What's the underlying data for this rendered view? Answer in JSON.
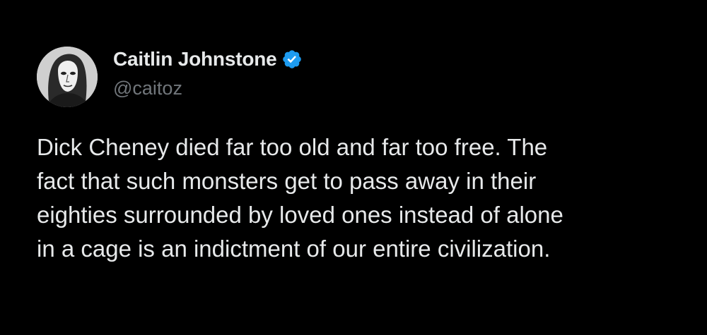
{
  "tweet": {
    "author": {
      "display_name": "Caitlin Johnstone",
      "handle": "@caitoz",
      "verified": true,
      "verified_icon": "verified-badge-icon",
      "verified_color": "#1d9bf0"
    },
    "text": "Dick Cheney died far too old and far too free. The\nfact that such monsters get to pass away in their\neighties surrounded by loved ones instead of alone\nin a cage is an indictment of our entire civilization.",
    "background_color": "#000000",
    "text_color": "#e7e9ea",
    "secondary_text_color": "#71767b"
  }
}
